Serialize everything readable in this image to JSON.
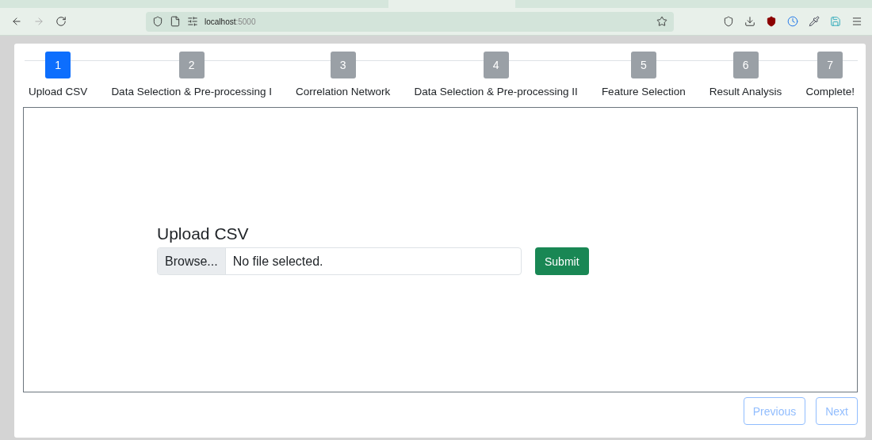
{
  "browser": {
    "back_disabled": false,
    "forward_disabled": true,
    "url": {
      "host": "localhost",
      "port": ":5000"
    }
  },
  "steps": [
    {
      "number": "1",
      "label": "Upload CSV",
      "selected": true
    },
    {
      "number": "2",
      "label": "Data Selection & Pre-processing I",
      "selected": false
    },
    {
      "number": "3",
      "label": "Correlation Network",
      "selected": false
    },
    {
      "number": "4",
      "label": "Data Selection & Pre-processing II",
      "selected": false
    },
    {
      "number": "5",
      "label": "Feature Selection",
      "selected": false
    },
    {
      "number": "6",
      "label": "Result Analysis",
      "selected": false
    },
    {
      "number": "7",
      "label": "Complete!",
      "selected": false
    }
  ],
  "upload": {
    "heading": "Upload CSV",
    "browse": "Browse...",
    "file_status": "No file selected.",
    "submit": "Submit"
  },
  "nav_buttons": [
    {
      "label": "Previous",
      "disabled": true
    },
    {
      "label": "Next",
      "disabled": true
    }
  ]
}
